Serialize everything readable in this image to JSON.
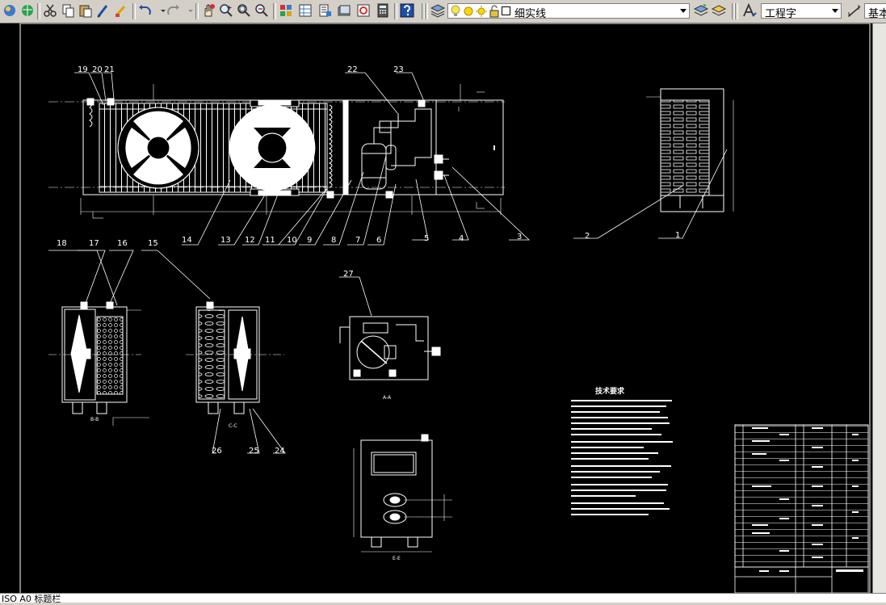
{
  "toolbar": {
    "layer_value": "细实线",
    "textstyle_value": "工程字",
    "dimstyle_value": "基本"
  },
  "colors": {
    "drawing_bg": "#000000",
    "line": "#ffffff"
  },
  "drawing": {
    "balloons": [
      "1",
      "2",
      "3",
      "4",
      "5",
      "6",
      "7",
      "8",
      "9",
      "10",
      "11",
      "12",
      "13",
      "14",
      "15",
      "16",
      "17",
      "18",
      "19",
      "20",
      "21",
      "22",
      "23",
      "24",
      "25",
      "26",
      "27"
    ],
    "views": {
      "section_a": "A-A",
      "section_b": "B-B",
      "section_c": "C-C",
      "section_e": "E-E"
    },
    "tech_title": "技术要求"
  },
  "status": {
    "text": "ISO A0 标题栏"
  }
}
